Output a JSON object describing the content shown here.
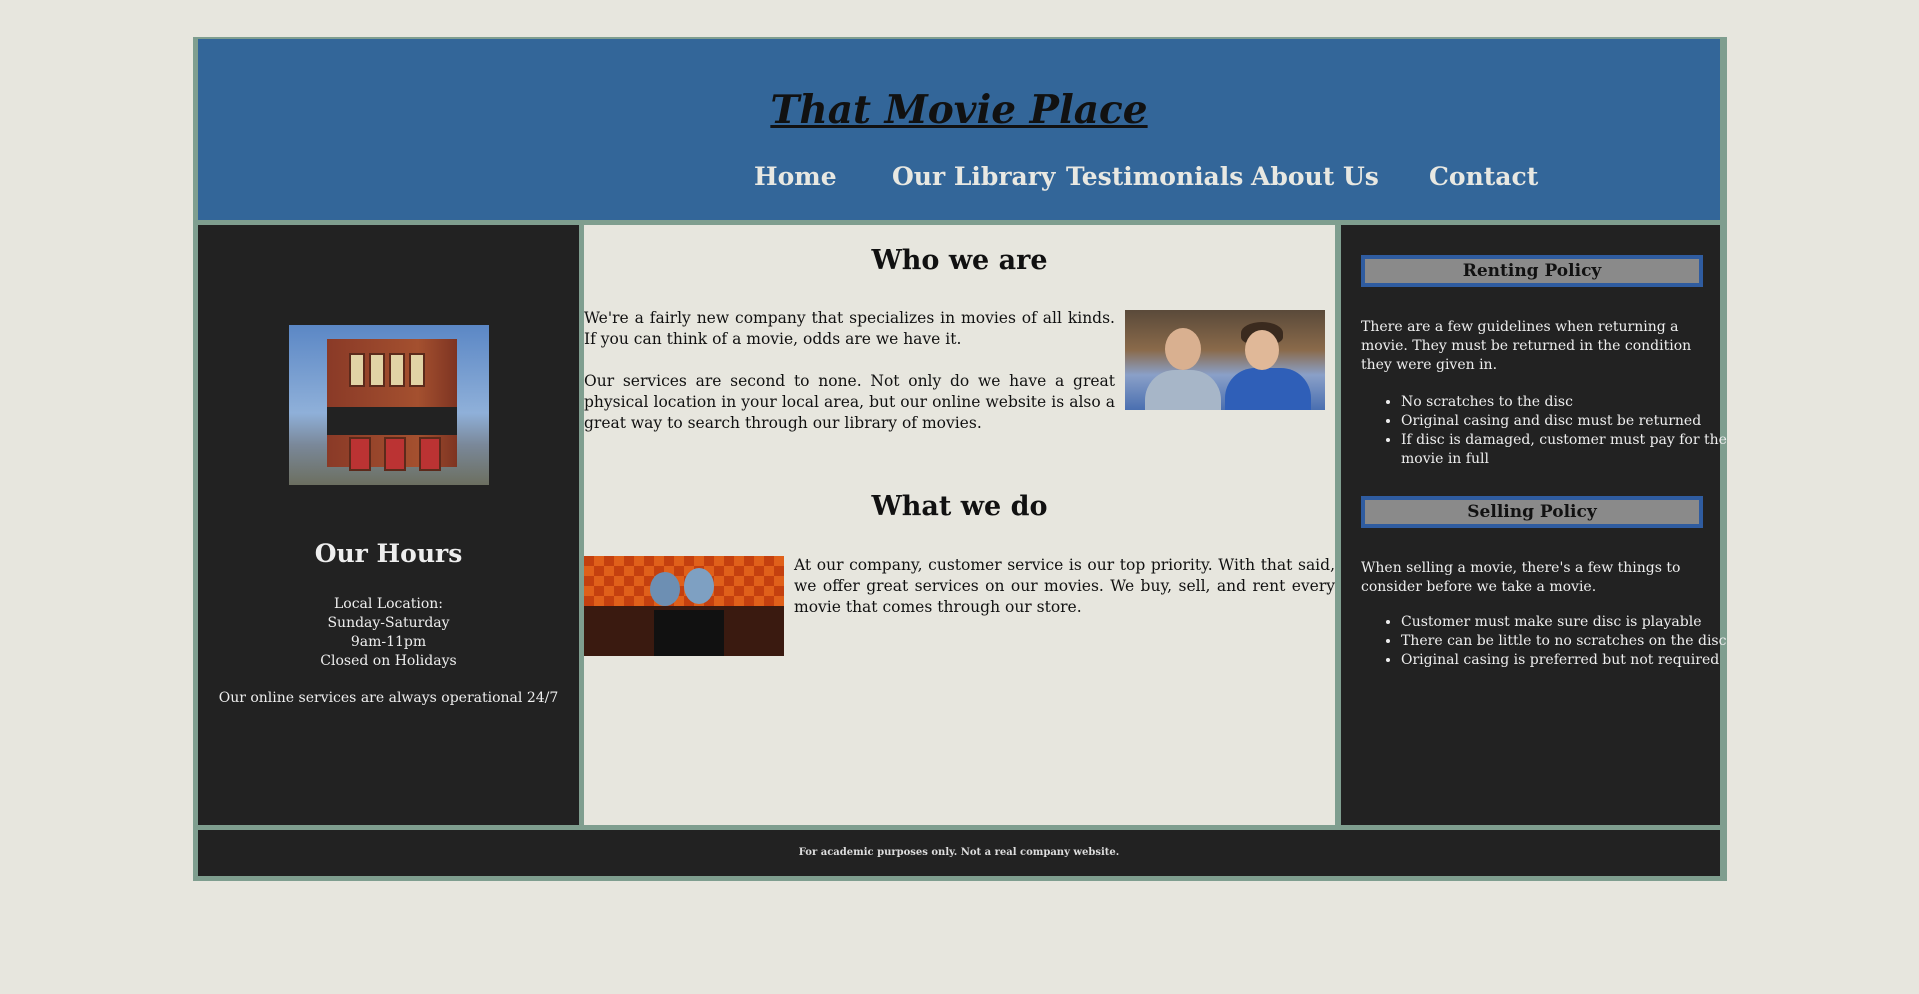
{
  "header": {
    "title": "That Movie Place",
    "nav": [
      "Home",
      "Our Library",
      "Testimonials",
      "About Us",
      "Contact"
    ]
  },
  "left": {
    "hours_title": "Our Hours",
    "hours_lines": [
      "Local Location:",
      "Sunday-Saturday",
      "9am-11pm",
      "Closed on Holidays"
    ],
    "online_note": "Our online services are always operational 24/7"
  },
  "main": {
    "who_title": "Who we are",
    "who_p1": "We're a fairly new company that specializes in movies of all kinds. If you can think of a movie, odds are we have it.",
    "who_p2": "Our services are second to none. Not only do we have a great physical location in your local area, but our online website is also a great way to search through our library of movies.",
    "what_title": "What we do",
    "what_p1": "At our company, customer service is our top priority. With that said, we offer great services on our movies. We buy, sell, and rent every movie that comes through our store."
  },
  "right": {
    "renting": {
      "title": "Renting Policy",
      "intro": "There are a few guidelines when returning a movie. They must be returned in the condition they were given in.",
      "items": [
        "No scratches to the disc",
        "Original casing and disc must be returned",
        "If disc is damaged, customer must pay for the movie in full"
      ]
    },
    "selling": {
      "title": "Selling Policy",
      "intro": "When selling a movie, there's a few things to consider before we take a movie.",
      "items": [
        "Customer must make sure disc is playable",
        "There can be little to no scratches on the disc",
        "Original casing is preferred but not required"
      ]
    }
  },
  "footer": {
    "note": "For academic purposes only. Not a real company website."
  },
  "colors": {
    "header_bg": "#336699",
    "panel_bg": "#222222",
    "page_bg": "#e7e6de",
    "border": "#7f9e8f",
    "policy_head_bg": "#8a8a8a",
    "policy_head_border": "#2f5ca0"
  }
}
